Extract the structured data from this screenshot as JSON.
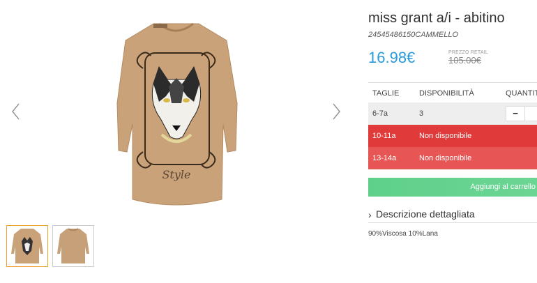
{
  "product": {
    "title": "miss grant a/i - abitino",
    "sku": "24545486150CAMMELLO",
    "price": "16.98€",
    "retail_label": "PREZZO RETAIL",
    "retail_price": "105.00€"
  },
  "sizes_table": {
    "headers": {
      "size": "TAGLIE",
      "availability": "DISPONIBILITÀ",
      "quantity": "QUANTITÀ"
    },
    "rows": [
      {
        "size": "6-7a",
        "availability": "3",
        "status": "available"
      },
      {
        "size": "10-11a",
        "availability": "Non disponibile",
        "status": "unavailable"
      },
      {
        "size": "13-14a",
        "availability": "Non disponibile",
        "status": "unavailable"
      }
    ],
    "minus_symbol": "−"
  },
  "add_to_cart_label": "Aggiungi al carrello",
  "description": {
    "toggle_label": "Descrizione dettagliata",
    "composition": "90%Viscosa 10%Lana"
  },
  "gallery": {
    "thumbnails": [
      "front",
      "back"
    ],
    "selected_index": 0
  },
  "colors": {
    "price": "#2a9ad8",
    "unavailable_row": "#e03a3a",
    "add_to_cart": "#5fd08a",
    "garment": "#c9a27a"
  }
}
